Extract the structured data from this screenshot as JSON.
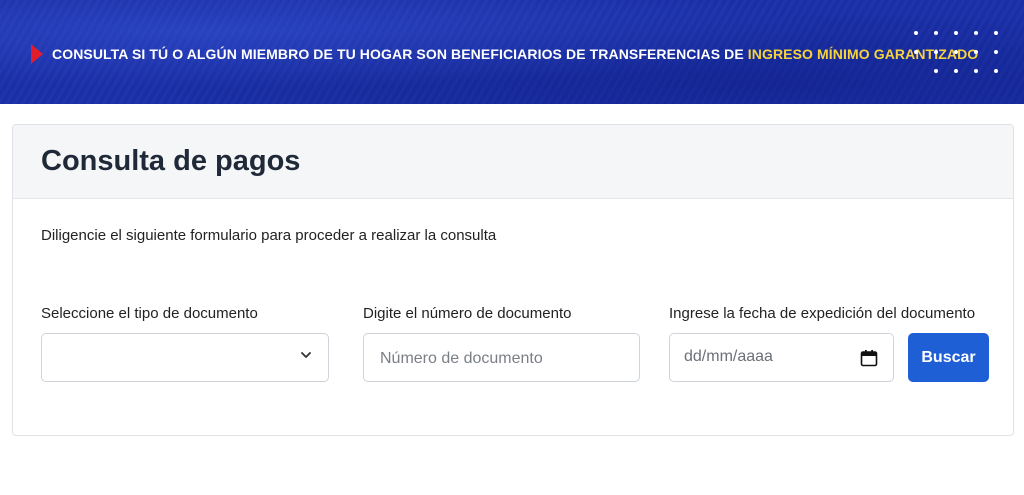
{
  "banner": {
    "text_main": "CONSULTA SI TÚ O ALGÚN MIEMBRO DE TU HOGAR SON BENEFICIARIOS DE TRANSFERENCIAS DE ",
    "text_highlight": "INGRESO MÍNIMO GARANTIZADO",
    "arrow_icon": "play-arrow-icon",
    "colors": {
      "background": "#1a2fa8",
      "arrow": "#e11d2b",
      "highlight": "#f6d33c"
    }
  },
  "card": {
    "title": "Consulta de pagos",
    "intro": "Diligencie el siguiente formulario para proceder a realizar la consulta"
  },
  "form": {
    "doc_type": {
      "label": "Seleccione el tipo de documento",
      "value": "",
      "icon": "chevron-down-icon"
    },
    "doc_number": {
      "label": "Digite el número de documento",
      "placeholder": "Número de documento",
      "value": ""
    },
    "issue_date": {
      "label": "Ingrese la fecha de expedición del documento",
      "placeholder": "dd/mm/aaaa",
      "icon": "calendar-icon"
    },
    "search_button": "Buscar"
  },
  "colors": {
    "accent": "#1f5fd6"
  }
}
